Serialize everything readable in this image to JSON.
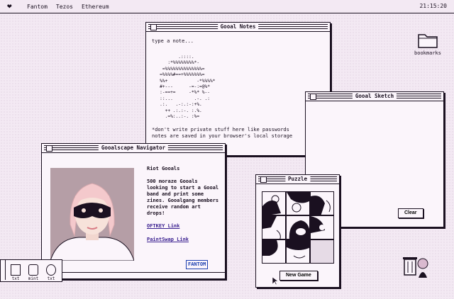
{
  "menubar": {
    "items": [
      "Fantom",
      "Tezos",
      "Ethereum"
    ],
    "clock": "21:15:20"
  },
  "icons": {
    "menu_logo": "broken-heart-icon",
    "bookmarks": "folder-icon",
    "trash": "trash-icon"
  },
  "desktop": {
    "bookmarks_label": "bookmarks"
  },
  "notes": {
    "title": "Gooal Notes",
    "placeholder": "type a note...",
    "ascii_art": "          .::::.\n      :*%%%%%%%%*-\n    =%%%%%%%%%%%%%%=\n   =%%%%#==+%%%%%%%=\n   %%+           -*%%%%*\n   #+---      -=-:=@%*\n   :-==+=     -*%* %--\n   ::...        .-. .:\n   .:.   .-:.:-:+%.\n     ++ .:.:-. :.%.\n     .=%:..:-. :%=",
    "warning_line1": "*don't write private stuff here like passwords",
    "warning_line2": "notes are saved in your browser's local storage"
  },
  "sketch": {
    "title": "Gooal Sketch",
    "clear_label": "Clear"
  },
  "profile": {
    "title": "Gooalscape Navigator",
    "name": "Riot Gooals",
    "description": "500 moraze Gooals looking to start a Gooal band and print some zines. Gooalgang members receive random art drops!",
    "link1": "OFTKEY Link",
    "link2": "PaintSwap Link",
    "badge": "FANTOM"
  },
  "puzzle": {
    "title": "Puzzle",
    "new_game_label": "New Game"
  },
  "dock": {
    "items": [
      {
        "label": "txt",
        "icon": "text-file-icon"
      },
      {
        "label": "mint",
        "icon": "mint-icon"
      },
      {
        "label": "txt",
        "icon": "text-file-icon"
      }
    ]
  },
  "colors": {
    "background": "#f3e9f3",
    "ink": "#1a1020",
    "link": "#3a2090",
    "fantom_blue": "#1b3fb0"
  }
}
